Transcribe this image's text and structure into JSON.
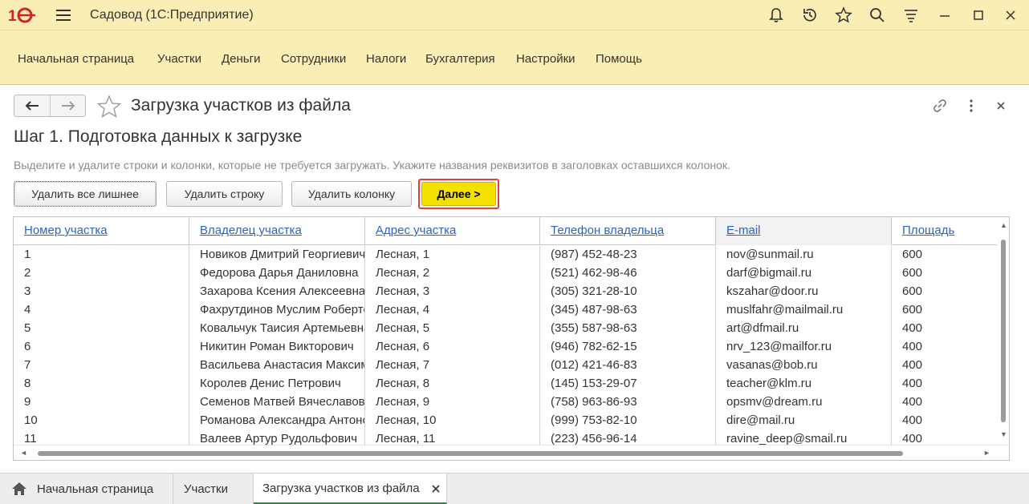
{
  "window": {
    "app_title": "Садовод  (1С:Предприятие)"
  },
  "sections": [
    {
      "label": "Начальная страница"
    },
    {
      "label": "Участки"
    },
    {
      "label": "Деньги"
    },
    {
      "label": "Сотрудники"
    },
    {
      "label": "Налоги"
    },
    {
      "label": "Бухгалтерия"
    },
    {
      "label": "Настройки"
    },
    {
      "label": "Помощь"
    }
  ],
  "form": {
    "title": "Загрузка участков из файла",
    "step_title": "Шаг 1. Подготовка данных к загрузке",
    "hint": "Выделите и удалите строки и колонки, которые не требуется загружать. Укажите названия реквизитов в заголовках оставшихся колонок.",
    "buttons": {
      "delete_extra": "Удалить все лишнее",
      "delete_row": "Удалить строку",
      "delete_column": "Удалить колонку",
      "next": "Далее >"
    }
  },
  "table": {
    "columns": [
      "Номер участка",
      "Владелец участка",
      "Адрес участка",
      "Телефон владельца",
      "E-mail",
      "Площадь"
    ],
    "rows": [
      [
        "1",
        "Новиков Дмитрий Георгиевич",
        "Лесная, 1",
        "(987) 452-48-23",
        "nov@sunmail.ru",
        "600"
      ],
      [
        "2",
        "Федорова Дарья Даниловна",
        "Лесная, 2",
        "(521) 462-98-46",
        "darf@bigmail.ru",
        "600"
      ],
      [
        "3",
        "Захарова Ксения Алексеевна",
        "Лесная, 3",
        "(305) 321-28-10",
        "kszahar@door.ru",
        "600"
      ],
      [
        "4",
        "Фахрутдинов Муслим Робертович",
        "Лесная, 4",
        "(345) 487-98-63",
        "muslfahr@mailmail.ru",
        "600"
      ],
      [
        "5",
        "Ковальчук Таисия Артемьевна",
        "Лесная, 5",
        "(355) 587-98-63",
        "art@dfmail.ru",
        "400"
      ],
      [
        "6",
        "Никитин Роман Викторович",
        "Лесная, 6",
        "(946) 782-62-15",
        "nrv_123@mailfor.ru",
        "400"
      ],
      [
        "7",
        "Васильева Анастасия Максимовна",
        "Лесная, 7",
        "(012) 421-46-83",
        "vasanas@bob.ru",
        "400"
      ],
      [
        "8",
        "Королев Денис Петрович",
        "Лесная, 8",
        "(145) 153-29-07",
        "teacher@klm.ru",
        "400"
      ],
      [
        "9",
        "Семенов Матвей Вячеславович",
        "Лесная, 9",
        "(758) 963-86-93",
        "opsmv@dream.ru",
        "400"
      ],
      [
        "10",
        "Романова Александра Антоновна",
        "Лесная, 10",
        "(999) 753-82-10",
        "dire@mail.ru",
        "400"
      ],
      [
        "11",
        "Валеев Артур Рудольфович",
        "Лесная, 11",
        "(223) 456-96-14",
        "ravine_deep@smail.ru",
        "400"
      ]
    ]
  },
  "open_windows": [
    {
      "label": "Начальная страница"
    },
    {
      "label": "Участки"
    },
    {
      "label": "Загрузка участков из файла"
    }
  ],
  "colors": {
    "panel_bg": "#fbeeb4",
    "next_button": "#f5e100",
    "link": "#2d63c6",
    "highlight_border": "#e0403a",
    "active_tab": "#2f8c3f"
  }
}
